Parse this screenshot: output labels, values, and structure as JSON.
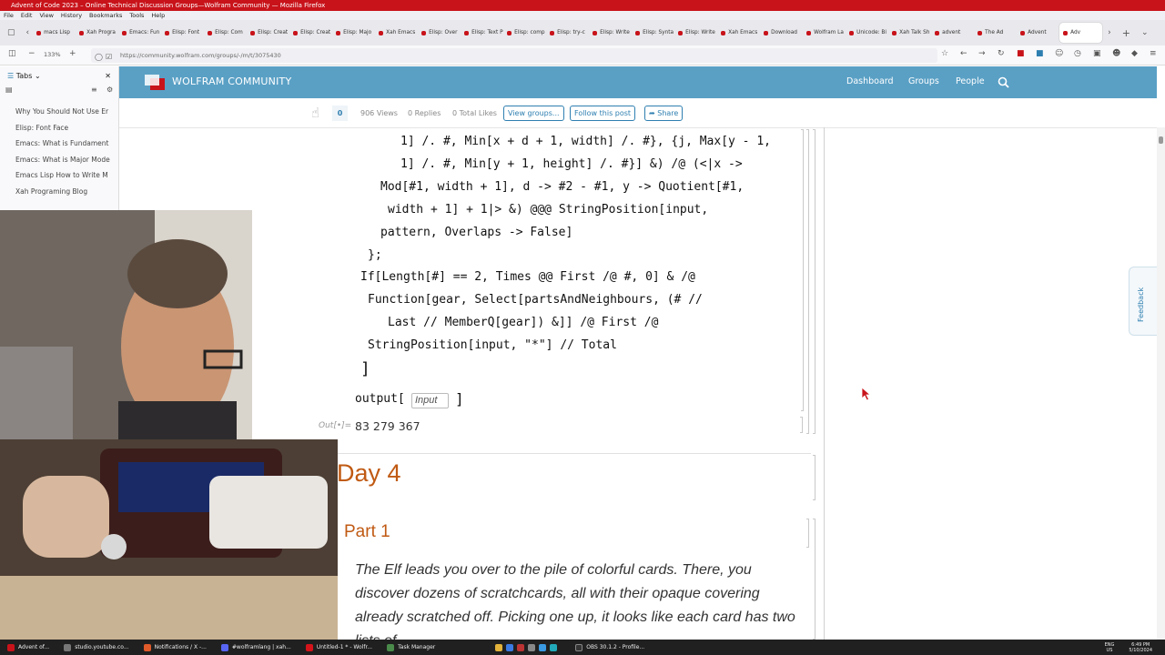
{
  "window": {
    "title": "Advent of Code 2023 – Online Technical Discussion Groups—Wolfram Community — Mozilla Firefox"
  },
  "menu": [
    "File",
    "Edit",
    "View",
    "History",
    "Bookmarks",
    "Tools",
    "Help"
  ],
  "tabs": [
    "macs Lisp",
    "Xah Progra",
    "Emacs: Fun",
    "Elisp: Font",
    "Elisp: Com",
    "Elisp: Creat",
    "Elisp: Creat",
    "Elisp: Majo",
    "Xah Emacs",
    "Elisp: Over",
    "Elisp: Text P",
    "Elisp: comp",
    "Elisp: try-c",
    "Elisp: Write",
    "Elisp: Synta",
    "Elisp: Write",
    "Xah Emacs",
    "Download",
    "Wolfram La",
    "Unicode: Bi",
    "Xah Talk Sh",
    "advent",
    "The Ad",
    "Advent",
    "Adv"
  ],
  "active_tab_index": 24,
  "address": {
    "zoom": "133%",
    "url": "https://community.wolfram.com/groups/-/m/t/3075430"
  },
  "sidebar": {
    "header": "Tabs",
    "items": [
      "Why You Should Not Use Er",
      "Elisp: Font Face",
      "Emacs: What is Fundament",
      "Emacs: What is Major Mode",
      "Emacs Lisp How to Write M",
      "Xah Programing Blog"
    ]
  },
  "site": {
    "name": "WOLFRAM COMMUNITY",
    "nav": [
      "Dashboard",
      "Groups",
      "People"
    ]
  },
  "post": {
    "likes": "0",
    "views": "906 Views",
    "replies": "0 Replies",
    "total_likes": "0 Total Likes",
    "view_groups": "View groups...",
    "follow": "Follow this post",
    "share": "Share"
  },
  "code_lines": [
    "1] /. #, Min[x + d + 1, width] /. #}, {j, Max[y - 1,",
    "1] /. #, Min[y + 1, height] /. #}] &) /@ (<|x ->",
    "Mod[#1, width + 1], d -> #2 - #1, y -> Quotient[#1,",
    "width + 1] + 1|> &) @@@ StringPosition[input,",
    "pattern, Overlaps -> False]",
    "};",
    "If[Length[#] == 2, Times @@ First /@ #, 0] & /@",
    "Function[gear, Select[partsAndNeighbours, (# //",
    "Last // MemberQ[gear]) &]] /@ First /@",
    "StringPosition[input, \"*\"] // Total",
    "]"
  ],
  "input_cell": {
    "func": "output[",
    "placeholder": "Input",
    "close": "]"
  },
  "output_cell": {
    "label": "Out[•]=",
    "value": "83 279 367"
  },
  "section": {
    "day": "Day 4",
    "part": "Part 1",
    "paragraph": "The Elf leads you over to the pile of colorful cards. There, you discover dozens of scratchcards, all with their opaque covering already scratched off. Picking one up, it looks like each card has two lists of"
  },
  "feedback": "Feedback",
  "taskbar": {
    "items": [
      "Advent of...",
      "studio.youtube.co...",
      "Notifications / X -...",
      "#wolframlang | xah...",
      "Untitled-1 * - Wolfr...",
      "Task Manager",
      "OBS 30.1.2 - Profile..."
    ],
    "lang": "ENG",
    "region": "US",
    "time": "6:49 PM",
    "date": "5/10/2024"
  },
  "colors": {
    "titlebar": "#c8131a",
    "header": "#5aa0c5",
    "accent_orange": "#c05a13",
    "link_blue": "#2e7fb0"
  }
}
